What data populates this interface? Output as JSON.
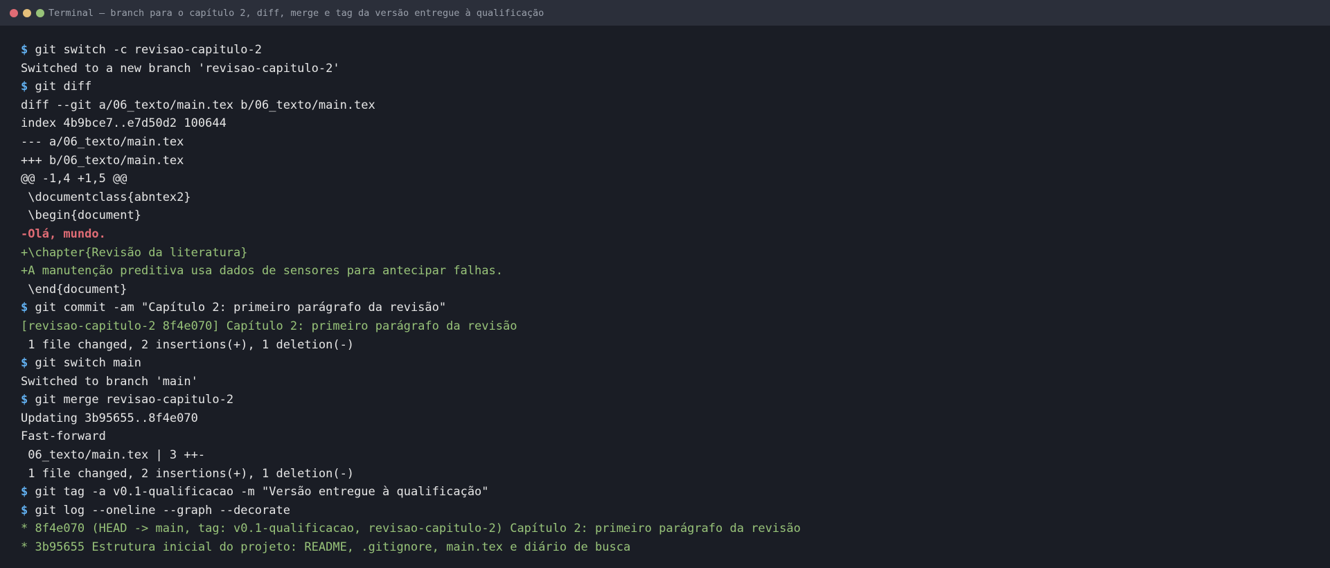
{
  "window": {
    "title": "Terminal — branch para o capítulo 2, diff, merge e tag da versão entregue à qualificação"
  },
  "colors": {
    "background": "#1a1d25",
    "titlebar": "#2b2f3a",
    "prompt": "#61afef",
    "output": "#e6e6e6",
    "deletion": "#e06c75",
    "addition": "#98c379"
  },
  "prompt_symbol": "$",
  "lines": [
    {
      "kind": "command",
      "text": "git switch -c revisao-capitulo-2"
    },
    {
      "kind": "output",
      "text": "Switched to a new branch 'revisao-capitulo-2'"
    },
    {
      "kind": "command",
      "text": "git diff"
    },
    {
      "kind": "output",
      "text": "diff --git a/06_texto/main.tex b/06_texto/main.tex"
    },
    {
      "kind": "output",
      "text": "index 4b9bce7..e7d50d2 100644"
    },
    {
      "kind": "output",
      "text": "--- a/06_texto/main.tex"
    },
    {
      "kind": "output",
      "text": "+++ b/06_texto/main.tex"
    },
    {
      "kind": "output",
      "text": "@@ -1,4 +1,5 @@"
    },
    {
      "kind": "output",
      "text": " \\documentclass{abntex2}"
    },
    {
      "kind": "output",
      "text": " \\begin{document}"
    },
    {
      "kind": "del",
      "text": "-Olá, mundo."
    },
    {
      "kind": "add",
      "text": "+\\chapter{Revisão da literatura}"
    },
    {
      "kind": "add",
      "text": "+A manutenção preditiva usa dados de sensores para antecipar falhas."
    },
    {
      "kind": "output",
      "text": " \\end{document}"
    },
    {
      "kind": "command",
      "text": "git commit -am \"Capítulo 2: primeiro parágrafo da revisão\""
    },
    {
      "kind": "add",
      "text": "[revisao-capitulo-2 8f4e070] Capítulo 2: primeiro parágrafo da revisão"
    },
    {
      "kind": "output",
      "text": " 1 file changed, 2 insertions(+), 1 deletion(-)"
    },
    {
      "kind": "command",
      "text": "git switch main"
    },
    {
      "kind": "output",
      "text": "Switched to branch 'main'"
    },
    {
      "kind": "command",
      "text": "git merge revisao-capitulo-2"
    },
    {
      "kind": "output",
      "text": "Updating 3b95655..8f4e070"
    },
    {
      "kind": "output",
      "text": "Fast-forward"
    },
    {
      "kind": "output",
      "text": " 06_texto/main.tex | 3 ++-"
    },
    {
      "kind": "output",
      "text": " 1 file changed, 2 insertions(+), 1 deletion(-)"
    },
    {
      "kind": "command",
      "text": "git tag -a v0.1-qualificacao -m \"Versão entregue à qualificação\""
    },
    {
      "kind": "command",
      "text": "git log --oneline --graph --decorate"
    },
    {
      "kind": "add",
      "text": "* 8f4e070 (HEAD -> main, tag: v0.1-qualificacao, revisao-capitulo-2) Capítulo 2: primeiro parágrafo da revisão"
    },
    {
      "kind": "add",
      "text": "* 3b95655 Estrutura inicial do projeto: README, .gitignore, main.tex e diário de busca"
    }
  ]
}
